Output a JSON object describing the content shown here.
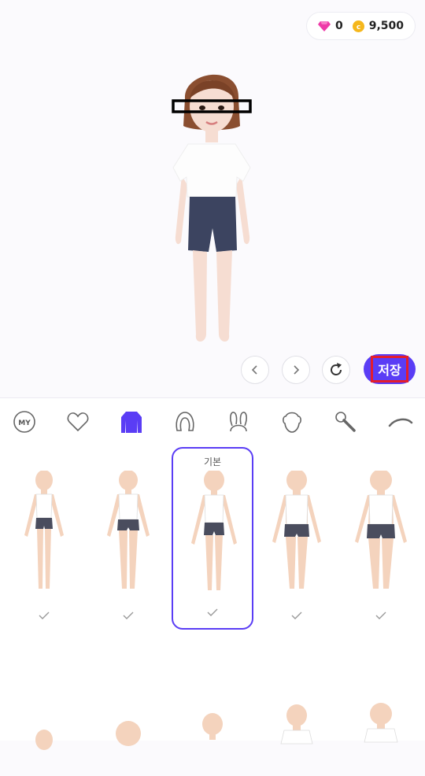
{
  "header": {
    "gem_count": "0",
    "coin_count": "9,500",
    "gem_icon": "gem-icon",
    "coin_icon": "coin-icon",
    "coin_symbol": "c"
  },
  "controls": {
    "prev_icon": "chevron-left-icon",
    "next_icon": "chevron-right-icon",
    "reset_icon": "refresh-icon",
    "save_label": "저장"
  },
  "categories": [
    {
      "icon": "my-icon",
      "text": "MY"
    },
    {
      "icon": "heart-icon"
    },
    {
      "icon": "body-icon",
      "active": true
    },
    {
      "icon": "hair-icon"
    },
    {
      "icon": "bunny-ears-icon"
    },
    {
      "icon": "face-icon"
    },
    {
      "icon": "microphone-icon"
    },
    {
      "icon": "eyebrow-icon"
    }
  ],
  "body_types": [
    {
      "label": ""
    },
    {
      "label": ""
    },
    {
      "label": "기본",
      "selected": true
    },
    {
      "label": ""
    },
    {
      "label": ""
    }
  ],
  "colors": {
    "accent": "#5a3df5",
    "highlight": "#e31d2c"
  }
}
